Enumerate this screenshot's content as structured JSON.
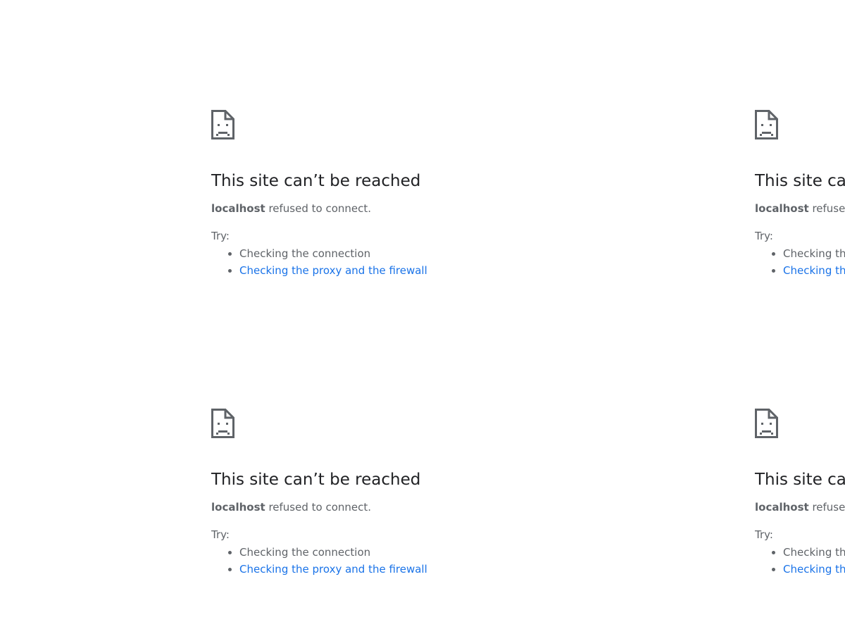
{
  "error_panels": [
    {
      "title": "This site can’t be reached",
      "host": "localhost",
      "message": " refused to connect.",
      "try_label": "Try:",
      "suggestions": [
        {
          "text": "Checking the connection"
        },
        {
          "text": "Checking the proxy and the firewall"
        }
      ]
    },
    {
      "title": "This site can’t be reached",
      "host": "localhost",
      "message": " refused to connect.",
      "try_label": "Try:",
      "suggestions": [
        {
          "text": "Checking the connection"
        },
        {
          "text": "Checking the proxy and the firewall"
        }
      ]
    },
    {
      "title": "This site can’t be reached",
      "host": "localhost",
      "message": " refused to connect.",
      "try_label": "Try:",
      "suggestions": [
        {
          "text": "Checking the connection"
        },
        {
          "text": "Checking the proxy and the firewall"
        }
      ]
    },
    {
      "title": "This site can’t be reached",
      "host": "localhost",
      "message": " refused to connect.",
      "try_label": "Try:",
      "suggestions": [
        {
          "text": "Checking the connection"
        },
        {
          "text": "Checking the proxy and the firewall"
        }
      ]
    }
  ],
  "icon": "sad-document-icon",
  "colors": {
    "title": "#202124",
    "text": "#5f6368",
    "link": "#1a73e8",
    "background": "#ffffff"
  }
}
